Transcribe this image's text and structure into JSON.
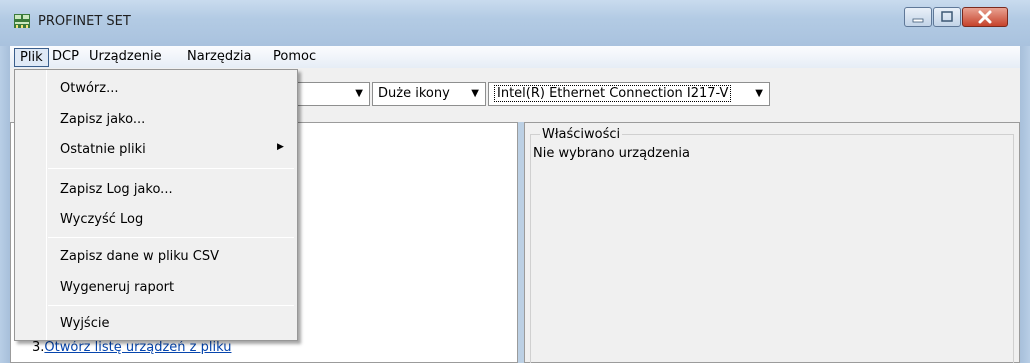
{
  "window": {
    "title": "PROFINET SET"
  },
  "menubar": [
    "Plik",
    "DCP",
    "Urządzenie",
    "Narzędzia",
    "Pomoc"
  ],
  "toolbar": {
    "view_mode": "Duże ikony",
    "adapter": "Intel(R) Ethernet Connection I217-V"
  },
  "file_menu": {
    "items": [
      "Otwórz...",
      "Zapisz jako...",
      "Ostatnie pliki",
      "Zapisz Log jako...",
      "Wyczyść Log",
      "Zapisz dane w pliku CSV",
      "Wygeneruj raport",
      "Wyjście"
    ]
  },
  "properties": {
    "title": "Właściwości",
    "text": "Nie wybrano urządzenia"
  },
  "left_panel": {
    "link_number": "3.",
    "link_text": "Otwórz listę urządzeń z pliku"
  }
}
